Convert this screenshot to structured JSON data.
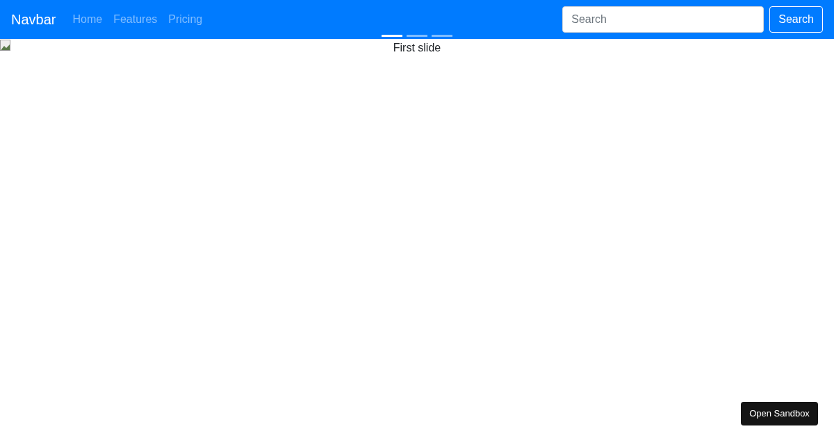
{
  "navbar": {
    "brand": "Navbar",
    "links": [
      {
        "label": "Home"
      },
      {
        "label": "Features"
      },
      {
        "label": "Pricing"
      }
    ],
    "search": {
      "placeholder": "Search",
      "button": "Search"
    }
  },
  "carousel": {
    "indicators": [
      {
        "selected": true
      },
      {
        "selected": false
      },
      {
        "selected": false
      }
    ],
    "slide_alt": "First slide"
  },
  "sandbox_button": "Open Sandbox"
}
